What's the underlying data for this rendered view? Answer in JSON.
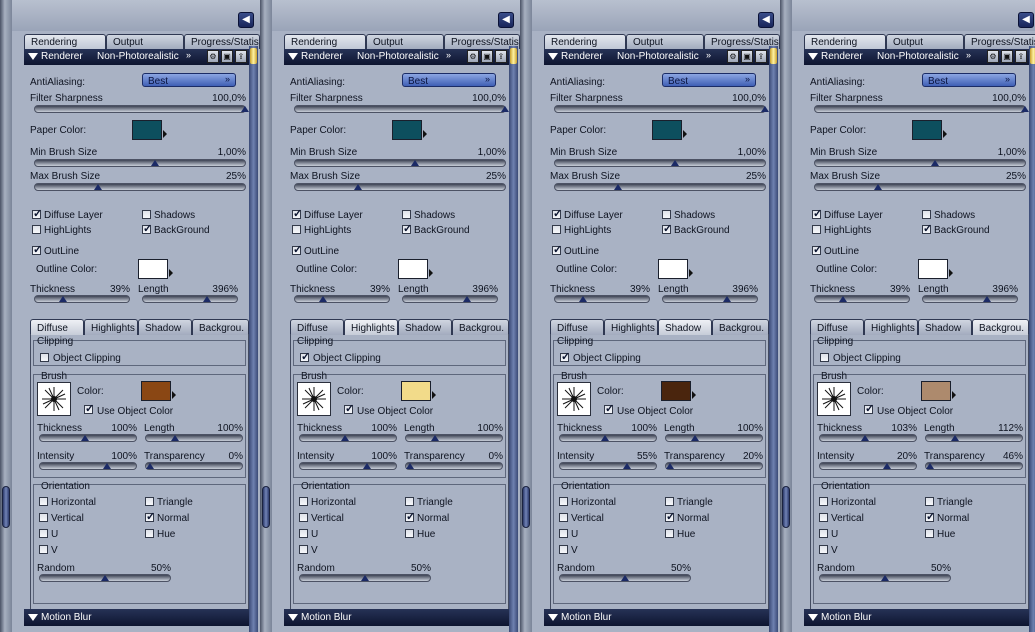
{
  "panels": [
    {
      "tabs": [
        "Rendering",
        "Output",
        "Progress/Statist."
      ],
      "renderer_label": "Renderer",
      "renderer_value": "Non-Photorealistic",
      "antialiasing_label": "AntiAliasing:",
      "antialiasing_value": "Best",
      "filter_sharpness_label": "Filter Sharpness",
      "filter_sharpness_value": "100,0%",
      "paper_color_label": "Paper Color:",
      "paper_color": "#0d4f5e",
      "min_brush_label": "Min Brush Size",
      "min_brush_value": "1,00%",
      "max_brush_label": "Max Brush Size",
      "max_brush_value": "25%",
      "diffuse_layer": "Diffuse Layer",
      "shadows": "Shadows",
      "highlights": "HighLights",
      "background": "BackGround",
      "outline": "OutLine",
      "outline_color_label": "Outline Color:",
      "outline_color": "#ffffff",
      "thickness_label": "Thickness",
      "thickness_value": "39%",
      "length_label": "Length",
      "length_value": "396%",
      "subtabs": [
        "Diffuse",
        "Highlights",
        "Shadow",
        "Backgrou."
      ],
      "active_subtab": 0,
      "clipping_title": "Clipping",
      "object_clipping": "Object Clipping",
      "object_clipping_checked": false,
      "brush_title": "Brush",
      "brush_color_label": "Color:",
      "brush_color": "#8a4714",
      "use_object_color": "Use Object Color",
      "b_thickness_label": "Thickness",
      "b_thickness_value": "100%",
      "b_length_label": "Length",
      "b_length_value": "100%",
      "intensity_label": "Intensity",
      "intensity_value": "100%",
      "transparency_label": "Transparency",
      "transparency_value": "0%",
      "orientation_title": "Orientation",
      "horizontal": "Horizontal",
      "triangle": "Triangle",
      "vertical": "Vertical",
      "normal": "Normal",
      "u": "U",
      "hue": "Hue",
      "v": "V",
      "random_label": "Random",
      "random_value": "50%",
      "motion_blur": "Motion Blur"
    },
    {
      "tabs": [
        "Rendering",
        "Output",
        "Progress/Statist."
      ],
      "renderer_label": "Renderer",
      "renderer_value": "Non-Photorealistic",
      "antialiasing_label": "AntiAliasing:",
      "antialiasing_value": "Best",
      "filter_sharpness_label": "Filter Sharpness",
      "filter_sharpness_value": "100,0%",
      "paper_color_label": "Paper Color:",
      "paper_color": "#0d4f5e",
      "min_brush_label": "Min Brush Size",
      "min_brush_value": "1,00%",
      "max_brush_label": "Max Brush Size",
      "max_brush_value": "25%",
      "diffuse_layer": "Diffuse Layer",
      "shadows": "Shadows",
      "highlights": "HighLights",
      "background": "BackGround",
      "outline": "OutLine",
      "outline_color_label": "Outline Color:",
      "outline_color": "#ffffff",
      "thickness_label": "Thickness",
      "thickness_value": "39%",
      "length_label": "Length",
      "length_value": "396%",
      "subtabs": [
        "Diffuse",
        "Highlights",
        "Shadow",
        "Backgrou."
      ],
      "active_subtab": 1,
      "clipping_title": "Clipping",
      "object_clipping": "Object Clipping",
      "object_clipping_checked": true,
      "brush_title": "Brush",
      "brush_color_label": "Color:",
      "brush_color": "#f2db8a",
      "use_object_color": "Use Object Color",
      "b_thickness_label": "Thickness",
      "b_thickness_value": "100%",
      "b_length_label": "Length",
      "b_length_value": "100%",
      "intensity_label": "Intensity",
      "intensity_value": "100%",
      "transparency_label": "Transparency",
      "transparency_value": "0%",
      "orientation_title": "Orientation",
      "horizontal": "Horizontal",
      "triangle": "Triangle",
      "vertical": "Vertical",
      "normal": "Normal",
      "u": "U",
      "hue": "Hue",
      "v": "V",
      "random_label": "Random",
      "random_value": "50%",
      "motion_blur": "Motion Blur"
    },
    {
      "tabs": [
        "Rendering",
        "Output",
        "Progress/Statist."
      ],
      "renderer_label": "Renderer",
      "renderer_value": "Non-Photorealistic",
      "antialiasing_label": "AntiAliasing:",
      "antialiasing_value": "Best",
      "filter_sharpness_label": "Filter Sharpness",
      "filter_sharpness_value": "100,0%",
      "paper_color_label": "Paper Color:",
      "paper_color": "#0d4f5e",
      "min_brush_label": "Min Brush Size",
      "min_brush_value": "1,00%",
      "max_brush_label": "Max Brush Size",
      "max_brush_value": "25%",
      "diffuse_layer": "Diffuse Layer",
      "shadows": "Shadows",
      "highlights": "HighLights",
      "background": "BackGround",
      "outline": "OutLine",
      "outline_color_label": "Outline Color:",
      "outline_color": "#ffffff",
      "thickness_label": "Thickness",
      "thickness_value": "39%",
      "length_label": "Length",
      "length_value": "396%",
      "subtabs": [
        "Diffuse",
        "Highlights",
        "Shadow",
        "Backgrou."
      ],
      "active_subtab": 2,
      "clipping_title": "Clipping",
      "object_clipping": "Object Clipping",
      "object_clipping_checked": true,
      "brush_title": "Brush",
      "brush_color_label": "Color:",
      "brush_color": "#4a250d",
      "use_object_color": "Use Object Color",
      "b_thickness_label": "Thickness",
      "b_thickness_value": "100%",
      "b_length_label": "Length",
      "b_length_value": "100%",
      "intensity_label": "Intensity",
      "intensity_value": "55%",
      "transparency_label": "Transparency",
      "transparency_value": "20%",
      "orientation_title": "Orientation",
      "horizontal": "Horizontal",
      "triangle": "Triangle",
      "vertical": "Vertical",
      "normal": "Normal",
      "u": "U",
      "hue": "Hue",
      "v": "V",
      "random_label": "Random",
      "random_value": "50%",
      "motion_blur": "Motion Blur"
    },
    {
      "tabs": [
        "Rendering",
        "Output",
        "Progress/Statist."
      ],
      "renderer_label": "Renderer",
      "renderer_value": "Non-Photorealistic",
      "antialiasing_label": "AntiAliasing:",
      "antialiasing_value": "Best",
      "filter_sharpness_label": "Filter Sharpness",
      "filter_sharpness_value": "100,0%",
      "paper_color_label": "Paper Color:",
      "paper_color": "#0d4f5e",
      "min_brush_label": "Min Brush Size",
      "min_brush_value": "1,00%",
      "max_brush_label": "Max Brush Size",
      "max_brush_value": "25%",
      "diffuse_layer": "Diffuse Layer",
      "shadows": "Shadows",
      "highlights": "HighLights",
      "background": "BackGround",
      "outline": "OutLine",
      "outline_color_label": "Outline Color:",
      "outline_color": "#ffffff",
      "thickness_label": "Thickness",
      "thickness_value": "39%",
      "length_label": "Length",
      "length_value": "396%",
      "subtabs": [
        "Diffuse",
        "Highlights",
        "Shadow",
        "Backgrou."
      ],
      "active_subtab": 3,
      "clipping_title": "Clipping",
      "object_clipping": "Object Clipping",
      "object_clipping_checked": false,
      "brush_title": "Brush",
      "brush_color_label": "Color:",
      "brush_color": "#ad8a6d",
      "use_object_color": "Use Object Color",
      "b_thickness_label": "Thickness",
      "b_thickness_value": "103%",
      "b_length_label": "Length",
      "b_length_value": "112%",
      "intensity_label": "Intensity",
      "intensity_value": "20%",
      "transparency_label": "Transparency",
      "transparency_value": "46%",
      "orientation_title": "Orientation",
      "horizontal": "Horizontal",
      "triangle": "Triangle",
      "vertical": "Vertical",
      "normal": "Normal",
      "u": "U",
      "hue": "Hue",
      "v": "V",
      "random_label": "Random",
      "random_value": "50%",
      "motion_blur": "Motion Blur"
    }
  ]
}
